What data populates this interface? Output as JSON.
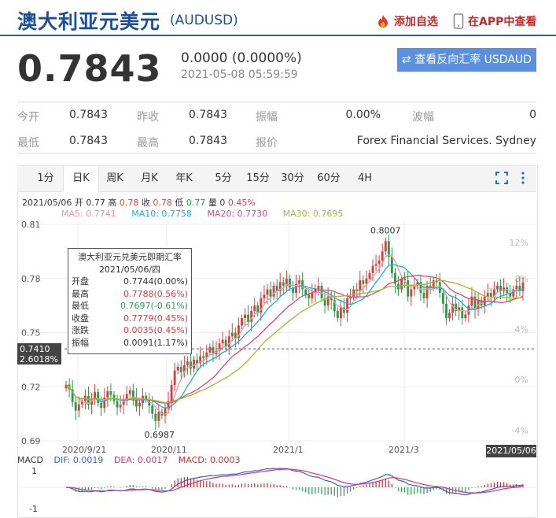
{
  "header": {
    "title": "澳大利亚元美元",
    "code": "(AUDUSD)",
    "add_watch": "添加自选",
    "open_app": "在APP中查看"
  },
  "quote": {
    "price": "0.7843",
    "change": "0.0000 (0.0000%)",
    "time": "2021-05-08 05:59:59",
    "reverse_button": "⇄ 查看反向汇率 USDAUD"
  },
  "stats": {
    "open_label": "今开",
    "open": "0.7843",
    "prev_label": "昨收",
    "prev": "0.7843",
    "amp_label": "振幅",
    "amp": "0.00%",
    "wave_label": "波幅",
    "wave": "0",
    "low_label": "最低",
    "low": "0.7843",
    "high_label": "最高",
    "high": "0.7843",
    "quote_label": "报价",
    "quote_src": "Forex Financial Services. Sydney"
  },
  "tabs": [
    "1分",
    "日K",
    "周K",
    "月K",
    "年K",
    "5分",
    "15分",
    "30分",
    "60分",
    "4H"
  ],
  "active_tab": "日K",
  "info_line": {
    "date": "2021/05/06",
    "open_l": "开",
    "open": "0.77",
    "high_l": "高",
    "high": "0.78",
    "close_l": "收",
    "close": "0.78",
    "low_l": "低",
    "low": "0.77",
    "vol_l": "量",
    "vol": "0",
    "pct": "0.45%"
  },
  "ma": {
    "ma5": "MA5: 0.7741",
    "ma10": "MA10: 0.7758",
    "ma20": "MA20: 0.7730",
    "ma30": "MA30: 0.7695"
  },
  "colors": {
    "up": "#e23a3a",
    "down": "#22a046",
    "ma5": "#e89aa4",
    "ma10": "#1ab0d0",
    "ma20": "#e0457b",
    "ma30": "#a7b832",
    "accent": "#1b4f9c"
  },
  "chart_data": {
    "type": "candlestick",
    "y_ticks": [
      "0.81",
      "0.78",
      "0.75",
      "0.72",
      "0.69"
    ],
    "pct_ticks": [
      "12%",
      "8%",
      "4%",
      "0%",
      "-4%"
    ],
    "x_ticks": [
      "2020/9/21",
      "2020/11",
      "2021/1",
      "2021/3"
    ],
    "ylim": [
      0.69,
      0.81
    ],
    "annotations": {
      "max": "0.8007",
      "min": "0.6987"
    },
    "crosshair": {
      "value": "0.7410",
      "pct": "2.6018%",
      "date": "2021/05/06"
    },
    "close_series": [
      0.7212,
      0.7185,
      0.7115,
      0.7067,
      0.7102,
      0.712,
      0.715,
      0.71,
      0.7135,
      0.717,
      0.711,
      0.7083,
      0.714,
      0.7175,
      0.7155,
      0.712,
      0.7085,
      0.71,
      0.713,
      0.716,
      0.718,
      0.714,
      0.709,
      0.711,
      0.715,
      0.713,
      0.7095,
      0.705,
      0.701,
      0.706,
      0.704,
      0.708,
      0.712,
      0.721,
      0.729,
      0.731,
      0.728,
      0.732,
      0.734,
      0.73,
      0.735,
      0.733,
      0.737,
      0.736,
      0.739,
      0.742,
      0.738,
      0.74,
      0.744,
      0.746,
      0.742,
      0.748,
      0.75,
      0.747,
      0.754,
      0.758,
      0.76,
      0.756,
      0.762,
      0.765,
      0.761,
      0.769,
      0.771,
      0.774,
      0.77,
      0.776,
      0.773,
      0.778,
      0.776,
      0.78,
      0.775,
      0.772,
      0.777,
      0.779,
      0.774,
      0.771,
      0.769,
      0.772,
      0.774,
      0.776,
      0.769,
      0.765,
      0.77,
      0.768,
      0.762,
      0.758,
      0.764,
      0.761,
      0.769,
      0.77,
      0.774,
      0.773,
      0.779,
      0.777,
      0.78,
      0.783,
      0.787,
      0.788,
      0.79,
      0.795,
      0.8007,
      0.792,
      0.783,
      0.777,
      0.774,
      0.78,
      0.779,
      0.77,
      0.774,
      0.776,
      0.778,
      0.772,
      0.769,
      0.776,
      0.775,
      0.779,
      0.778,
      0.772,
      0.766,
      0.758,
      0.761,
      0.766,
      0.762,
      0.764,
      0.758,
      0.76,
      0.765,
      0.77,
      0.763,
      0.768,
      0.765,
      0.77,
      0.772,
      0.77,
      0.774,
      0.776,
      0.773,
      0.775,
      0.772,
      0.77,
      0.774,
      0.776,
      0.773,
      0.7779
    ],
    "macd": {
      "dif": "DIF: 0.0019",
      "dea": "DEA: 0.0017",
      "macd": "MACD: 0.0003",
      "y_ticks": [
        "1",
        "-1"
      ]
    },
    "tooltip": {
      "title": "澳大利亚元兑美元即期汇率",
      "date": "2021/05/06/四",
      "rows": [
        {
          "label": "开盘",
          "value": "0.7744(0.00%)",
          "color": "#333"
        },
        {
          "label": "最高",
          "value": "0.7788(0.56%)",
          "color": "#e23a3a"
        },
        {
          "label": "最低",
          "value": "0.7697(-0.61%)",
          "color": "#22a046"
        },
        {
          "label": "收盘",
          "value": "0.7779(0.45%)",
          "color": "#e23a3a"
        },
        {
          "label": "涨跌",
          "value": "0.0035(0.45%)",
          "color": "#e23a3a"
        },
        {
          "label": "振幅",
          "value": "0.0091(1.17%)",
          "color": "#333"
        }
      ]
    }
  }
}
